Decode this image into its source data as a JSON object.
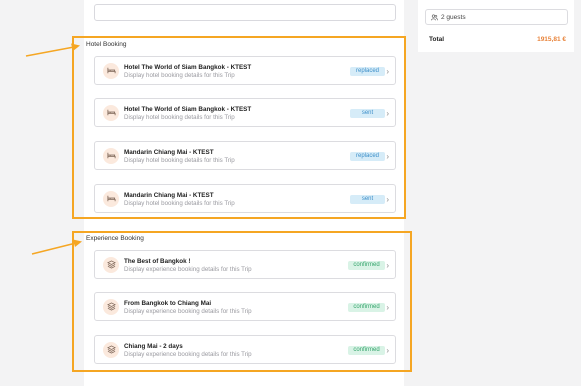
{
  "sidebar": {
    "guests_label": "2 guests",
    "total_label": "Total",
    "total_value": "1915,81 €"
  },
  "hotel_section": {
    "title": "Hotel Booking",
    "items": [
      {
        "title": "Hotel The World of Siam Bangkok - KTEST",
        "subtitle": "Display hotel booking details for this Trip",
        "status": "replaced"
      },
      {
        "title": "Hotel The World of Siam Bangkok - KTEST",
        "subtitle": "Display hotel booking details for this Trip",
        "status": "sent"
      },
      {
        "title": "Mandarin Chiang Mai - KTEST",
        "subtitle": "Display hotel booking details for this Trip",
        "status": "replaced"
      },
      {
        "title": "Mandarin Chiang Mai - KTEST",
        "subtitle": "Display hotel booking details for this Trip",
        "status": "sent"
      }
    ]
  },
  "experience_section": {
    "title": "Experience Booking",
    "items": [
      {
        "title": "The Best of Bangkok !",
        "subtitle": "Display experience booking details for this Trip",
        "status": "confirmed"
      },
      {
        "title": "From Bangkok to Chiang Mai",
        "subtitle": "Display experience booking details for this Trip",
        "status": "confirmed"
      },
      {
        "title": "Chiang Mai - 2 days",
        "subtitle": "Display experience booking details for this Trip",
        "status": "confirmed"
      }
    ]
  },
  "colors": {
    "highlight": "#f5a623",
    "total_accent": "#e8833a",
    "badge_blue": "#3d8fc9",
    "badge_green": "#34a46b"
  },
  "icons": {
    "hotel": "bed-icon",
    "experience": "layers-icon",
    "guests": "users-icon",
    "chevron": "chevron-right-icon"
  }
}
